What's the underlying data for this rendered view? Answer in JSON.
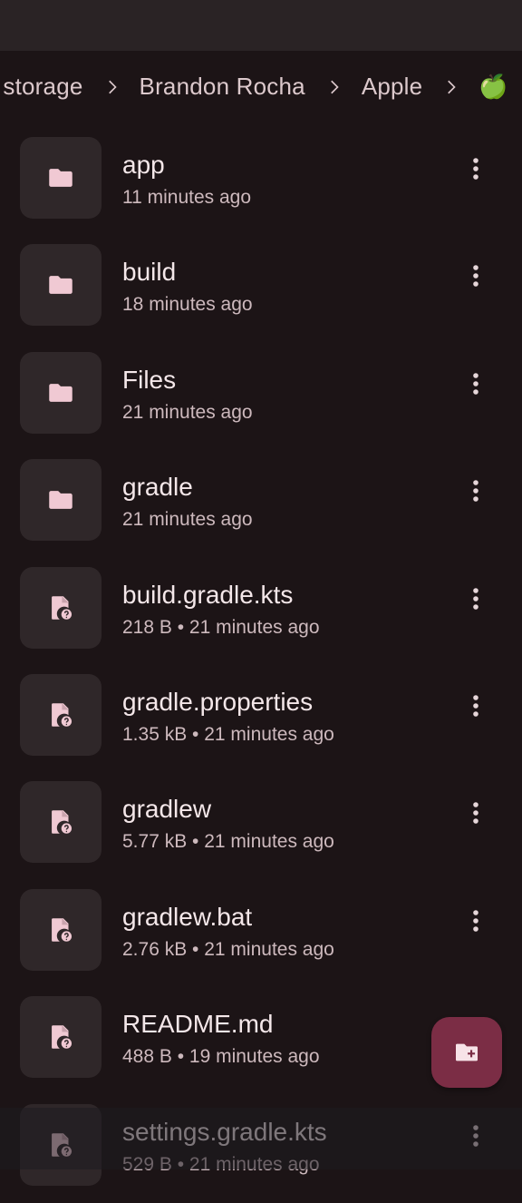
{
  "breadcrumb": {
    "items": [
      "l storage",
      "Brandon Rocha",
      "Apple",
      "🍏"
    ]
  },
  "files": [
    {
      "name": "app",
      "meta": "11 minutes ago",
      "kind": "folder"
    },
    {
      "name": "build",
      "meta": "18 minutes ago",
      "kind": "folder"
    },
    {
      "name": "Files",
      "meta": "21 minutes ago",
      "kind": "folder"
    },
    {
      "name": "gradle",
      "meta": "21 minutes ago",
      "kind": "folder"
    },
    {
      "name": "build.gradle.kts",
      "meta": "218 B • 21 minutes ago",
      "kind": "file"
    },
    {
      "name": "gradle.properties",
      "meta": "1.35 kB • 21 minutes ago",
      "kind": "file"
    },
    {
      "name": "gradlew",
      "meta": "5.77 kB • 21 minutes ago",
      "kind": "file"
    },
    {
      "name": "gradlew.bat",
      "meta": "2.76 kB • 21 minutes ago",
      "kind": "file"
    },
    {
      "name": "README.md",
      "meta": "488 B • 19 minutes ago",
      "kind": "file"
    },
    {
      "name": "settings.gradle.kts",
      "meta": "529 B • 21 minutes ago",
      "kind": "file"
    }
  ],
  "icons": {
    "folder": "folder-icon",
    "file": "unknown-file-icon",
    "more": "more-vert-icon",
    "fab": "create-folder-icon",
    "separator": "chevron-right-icon"
  },
  "colors": {
    "background": "#1c1416",
    "surface": "#2f2729",
    "icon_tint": "#f0c9d3",
    "fab": "#7b2d45"
  }
}
